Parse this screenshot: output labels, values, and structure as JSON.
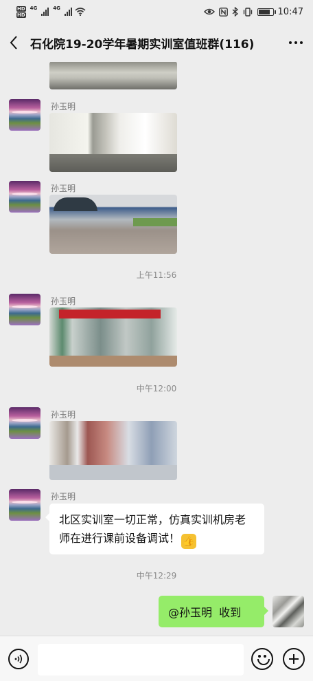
{
  "status_bar": {
    "hd_badges": [
      "HD",
      "HD"
    ],
    "network_tags": [
      "4G",
      "4G"
    ],
    "time": "10:47",
    "battery_level": 0.8,
    "icons": [
      "eye-icon",
      "nfc-icon",
      "bluetooth-icon",
      "vibrate-icon",
      "battery-icon",
      "wifi-icon",
      "signal-icon"
    ]
  },
  "header": {
    "title": "石化院19-20学年暑期实训室值班群(116)",
    "back_icon": "chevron-left-icon",
    "more_icon": "more-horizontal-icon"
  },
  "messages": [
    {
      "type": "image",
      "sender": "",
      "thumbnail": "hallway photo (partially scrolled)"
    },
    {
      "type": "image",
      "sender": "孙玉明",
      "thumbnail": "corridor photo"
    },
    {
      "type": "image",
      "sender": "孙玉明",
      "thumbnail": "courtyard photo"
    },
    {
      "type": "timestamp",
      "text": "上午11:56"
    },
    {
      "type": "image",
      "sender": "孙玉明",
      "thumbnail": "building entrance photo with red banner"
    },
    {
      "type": "timestamp",
      "text": "中午12:00"
    },
    {
      "type": "image",
      "sender": "孙玉明",
      "thumbnail": "lab room photo"
    },
    {
      "type": "text",
      "sender": "孙玉明",
      "text": "北区实训室一切正常，仿真实训机房老师在进行课前设备调试！",
      "emoji": "thumbs-up-icon"
    },
    {
      "type": "timestamp",
      "text": "中午12:29"
    },
    {
      "type": "text",
      "from_self": true,
      "text": "@孙玉明  收到"
    }
  ],
  "input_bar": {
    "voice_icon": "voice-icon",
    "emoji_icon": "emoji-icon",
    "plus_icon": "plus-icon"
  },
  "colors": {
    "background": "#ededed",
    "outgoing_bubble": "#95ec69",
    "incoming_bubble": "#ffffff",
    "input_bar": "#f7f7f7"
  }
}
